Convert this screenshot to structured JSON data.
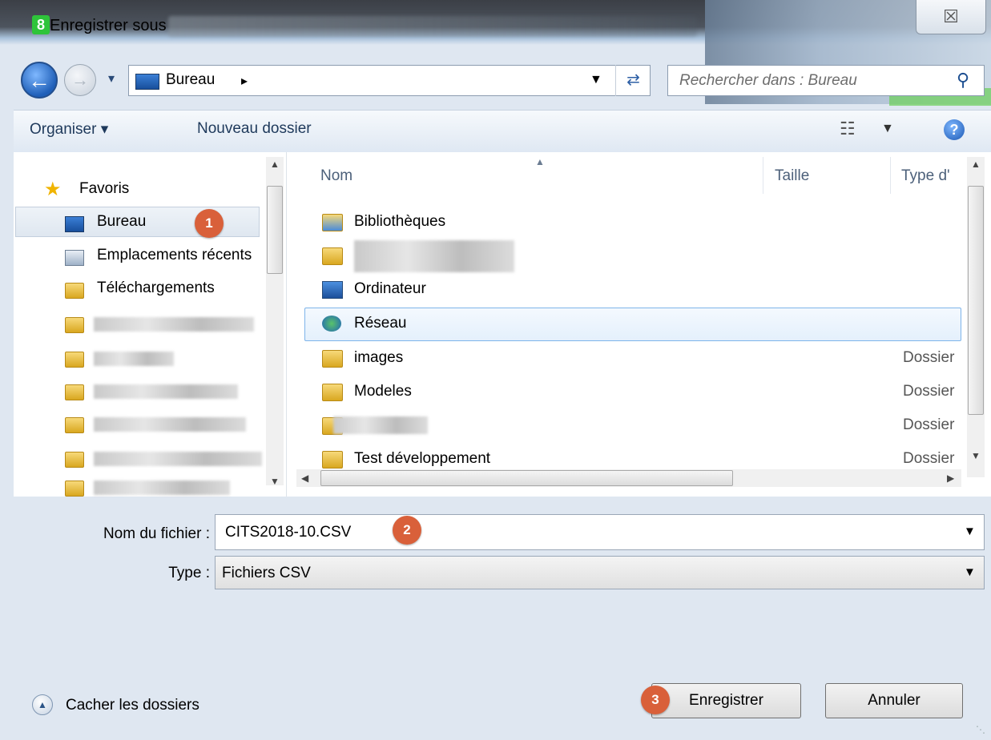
{
  "window": {
    "title": "Enregistrer sous",
    "app_icon": "app-logo-icon",
    "close_label": "☒"
  },
  "address": {
    "location": "Bureau",
    "search_placeholder": "Rechercher dans : Bureau"
  },
  "toolbar": {
    "organise_label": "Organiser ▾",
    "new_folder_label": "Nouveau dossier"
  },
  "nav": {
    "favorites_label": "Favoris",
    "items": [
      {
        "label": "Bureau"
      },
      {
        "label": "Emplacements récents"
      },
      {
        "label": "Téléchargements"
      }
    ]
  },
  "list": {
    "columns": [
      "Nom",
      "Taille",
      "Type d'"
    ],
    "rows": [
      {
        "name": "Bibliothèques",
        "type": ""
      },
      {
        "name": "",
        "type": ""
      },
      {
        "name": "Ordinateur",
        "type": ""
      },
      {
        "name": "Réseau",
        "type": ""
      },
      {
        "name": "images",
        "type": "Dossier"
      },
      {
        "name": "Modeles",
        "type": "Dossier"
      },
      {
        "name": "",
        "type": "Dossier"
      },
      {
        "name": "Test développement",
        "type": "Dossier"
      }
    ]
  },
  "form": {
    "filename_label": "Nom du fichier :",
    "filename_value": "CITS2018-10.CSV",
    "type_label": "Type :",
    "type_value": "Fichiers CSV"
  },
  "buttons": {
    "save": "Enregistrer",
    "cancel": "Annuler",
    "hide_folders": "Cacher les dossiers"
  },
  "badges": [
    "1",
    "2",
    "3"
  ],
  "colors": {
    "badge": "#d9603a",
    "accent": "#1d4f91"
  }
}
